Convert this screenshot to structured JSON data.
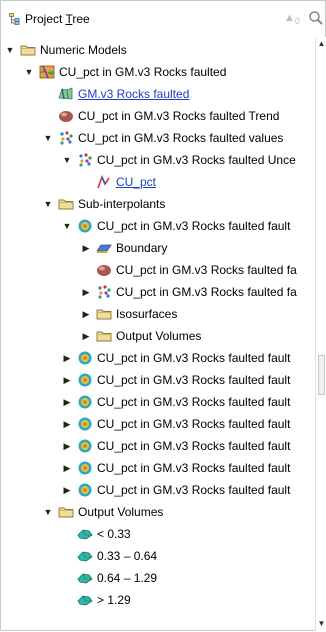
{
  "panel": {
    "title": "Project Tree",
    "title_pre": "Project ",
    "title_accel": "T",
    "title_post": "ree",
    "up_count": "0"
  },
  "tree": [
    {
      "name": "folder-numeric-models",
      "label": "Numeric Models",
      "icon": "folder-icon",
      "toggle": "expanded",
      "indent": 0
    },
    {
      "name": "model-cu-pct",
      "label": "CU_pct in GM.v3 Rocks faulted",
      "icon": "numeric-model-icon",
      "toggle": "expanded",
      "indent": 1
    },
    {
      "name": "link-gm-v3",
      "label": "GM.v3 Rocks faulted",
      "icon": "geology-model-icon",
      "toggle": "none",
      "indent": 2,
      "link": true
    },
    {
      "name": "item-trend",
      "label": "CU_pct in GM.v3 Rocks faulted Trend",
      "icon": "trend-ellipsoid-icon",
      "toggle": "none",
      "indent": 2
    },
    {
      "name": "item-values",
      "label": "CU_pct in GM.v3 Rocks faulted values",
      "icon": "points-icon",
      "toggle": "expanded",
      "indent": 2
    },
    {
      "name": "item-uncertainty",
      "label": "CU_pct in GM.v3 Rocks faulted Unce",
      "icon": "points-icon",
      "toggle": "expanded",
      "indent": 3
    },
    {
      "name": "link-cu-pct",
      "label": "CU_pct",
      "icon": "drillhole-icon",
      "toggle": "none",
      "indent": 4,
      "link": true
    },
    {
      "name": "folder-sub-interpolants",
      "label": "Sub-interpolants",
      "icon": "folder-icon",
      "toggle": "expanded",
      "indent": 2
    },
    {
      "name": "sub-interpolant-1",
      "label": "CU_pct in GM.v3 Rocks faulted fault",
      "icon": "interpolant-icon",
      "toggle": "expanded",
      "indent": 3
    },
    {
      "name": "item-boundary",
      "label": "Boundary",
      "icon": "boundary-icon",
      "toggle": "collapsed",
      "indent": 4
    },
    {
      "name": "item-sub-trend",
      "label": "CU_pct in GM.v3 Rocks faulted fa",
      "icon": "trend-ellipsoid-icon",
      "toggle": "none",
      "indent": 4
    },
    {
      "name": "item-sub-values",
      "label": "CU_pct in GM.v3 Rocks faulted fa",
      "icon": "points-icon",
      "toggle": "collapsed",
      "indent": 4
    },
    {
      "name": "folder-isosurfaces",
      "label": "Isosurfaces",
      "icon": "folder-icon",
      "toggle": "collapsed",
      "indent": 4
    },
    {
      "name": "folder-sub-output-volumes",
      "label": "Output Volumes",
      "icon": "folder-icon",
      "toggle": "collapsed",
      "indent": 4
    },
    {
      "name": "sub-interpolant-2",
      "label": "CU_pct in GM.v3 Rocks faulted fault",
      "icon": "interpolant-icon",
      "toggle": "collapsed",
      "indent": 3
    },
    {
      "name": "sub-interpolant-3",
      "label": "CU_pct in GM.v3 Rocks faulted fault",
      "icon": "interpolant-icon",
      "toggle": "collapsed",
      "indent": 3
    },
    {
      "name": "sub-interpolant-4",
      "label": "CU_pct in GM.v3 Rocks faulted fault",
      "icon": "interpolant-icon",
      "toggle": "collapsed",
      "indent": 3
    },
    {
      "name": "sub-interpolant-5",
      "label": "CU_pct in GM.v3 Rocks faulted fault",
      "icon": "interpolant-icon",
      "toggle": "collapsed",
      "indent": 3
    },
    {
      "name": "sub-interpolant-6",
      "label": "CU_pct in GM.v3 Rocks faulted fault",
      "icon": "interpolant-icon",
      "toggle": "collapsed",
      "indent": 3
    },
    {
      "name": "sub-interpolant-7",
      "label": "CU_pct in GM.v3 Rocks faulted fault",
      "icon": "interpolant-icon",
      "toggle": "collapsed",
      "indent": 3
    },
    {
      "name": "sub-interpolant-8",
      "label": "CU_pct in GM.v3 Rocks faulted fault",
      "icon": "interpolant-icon",
      "toggle": "collapsed",
      "indent": 3
    },
    {
      "name": "folder-output-volumes",
      "label": "Output Volumes",
      "icon": "folder-icon",
      "toggle": "expanded",
      "indent": 2
    },
    {
      "name": "volume-lt-033",
      "label": "< 0.33",
      "icon": "volume-icon",
      "toggle": "none",
      "indent": 3
    },
    {
      "name": "volume-033-064",
      "label": "0.33 – 0.64",
      "icon": "volume-icon",
      "toggle": "none",
      "indent": 3
    },
    {
      "name": "volume-064-129",
      "label": "0.64 – 1.29",
      "icon": "volume-icon",
      "toggle": "none",
      "indent": 3
    },
    {
      "name": "volume-gt-129",
      "label": "> 1.29",
      "icon": "volume-icon",
      "toggle": "none",
      "indent": 3
    }
  ],
  "colors": {
    "link": "#1f3fbf",
    "folder": "#e8d38a",
    "volume": "#2aa59a"
  }
}
